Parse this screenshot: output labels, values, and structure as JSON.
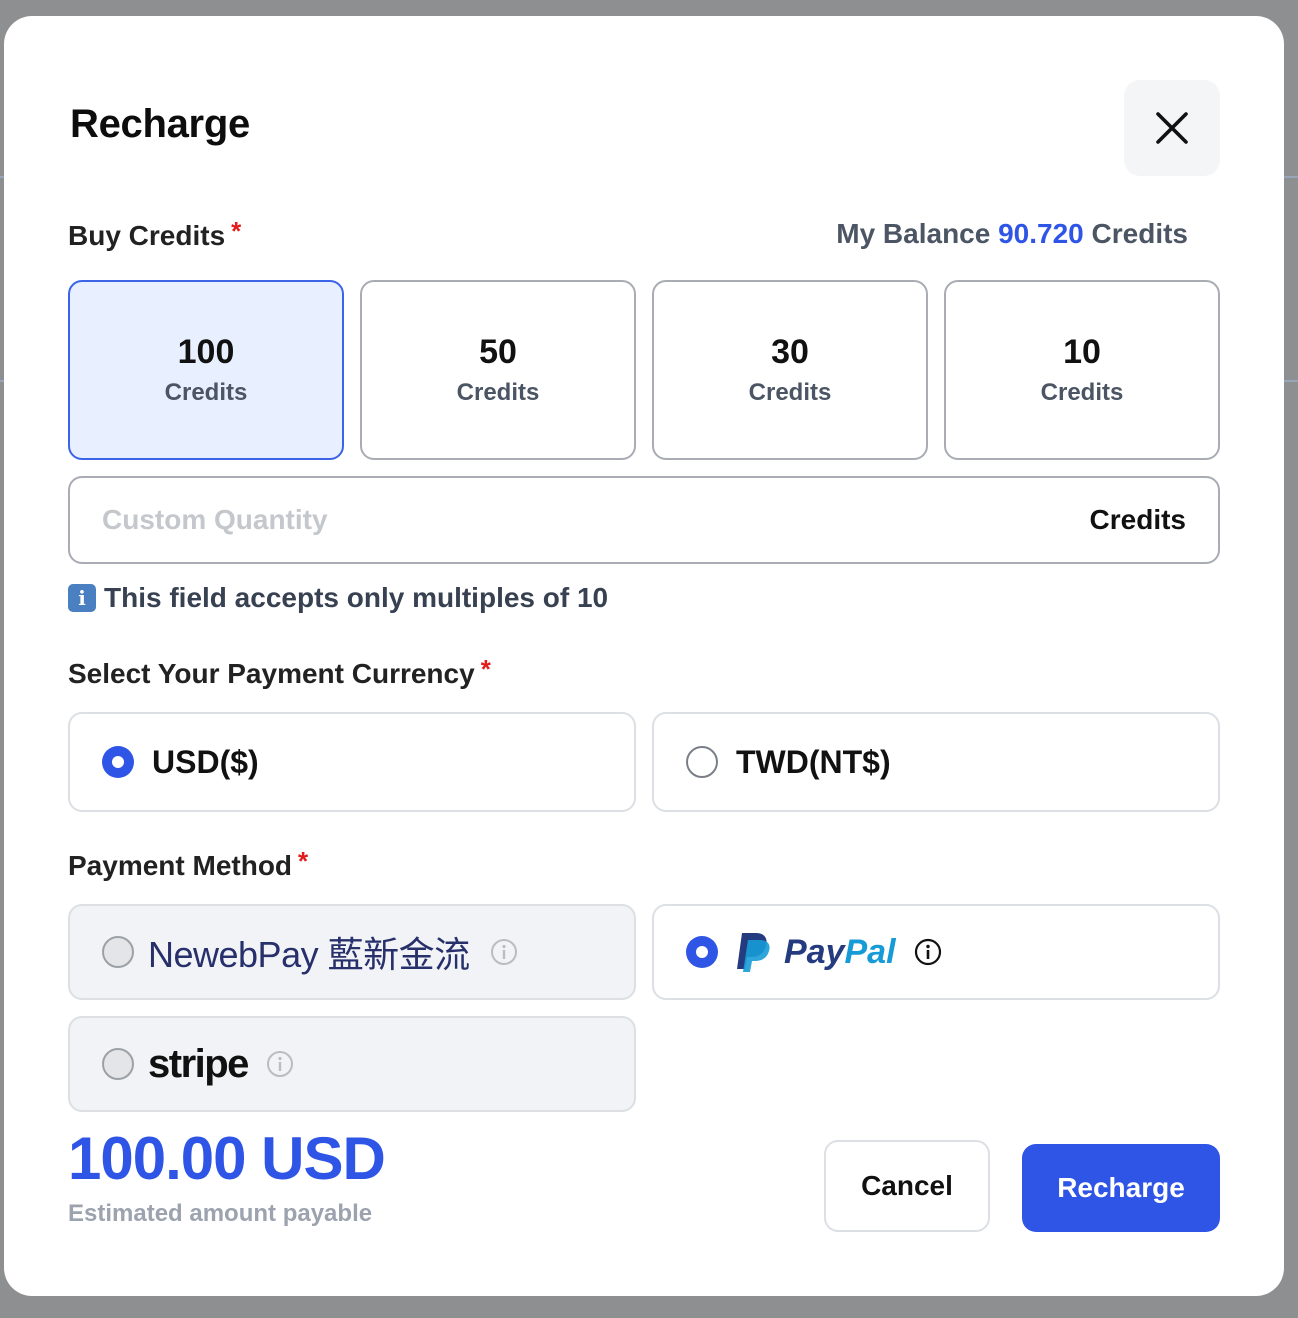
{
  "modal": {
    "title": "Recharge"
  },
  "buy_credits": {
    "label": "Buy Credits",
    "required_mark": "*",
    "balance_prefix": "My Balance",
    "balance_value": "90.720",
    "balance_suffix": "Credits",
    "options": [
      {
        "amount": "100",
        "unit": "Credits",
        "selected": true
      },
      {
        "amount": "50",
        "unit": "Credits",
        "selected": false
      },
      {
        "amount": "30",
        "unit": "Credits",
        "selected": false
      },
      {
        "amount": "10",
        "unit": "Credits",
        "selected": false
      }
    ],
    "custom_placeholder": "Custom Quantity",
    "custom_value": "",
    "custom_suffix": "Credits",
    "hint_icon": "i",
    "hint": "This field accepts only multiples of 10"
  },
  "currency": {
    "label": "Select Your Payment Currency",
    "required_mark": "*",
    "options": [
      {
        "label": "USD($)",
        "selected": true
      },
      {
        "label": "TWD(NT$)",
        "selected": false
      }
    ]
  },
  "payment_method": {
    "label": "Payment Method",
    "required_mark": "*",
    "options": [
      {
        "name": "NewebPay 藍新金流",
        "icon": "newebpay-logo",
        "selected": false,
        "disabled": true
      },
      {
        "name": "PayPal",
        "icon": "paypal-logo",
        "selected": true,
        "disabled": false
      },
      {
        "name": "stripe",
        "icon": "stripe-logo",
        "selected": false,
        "disabled": true
      }
    ]
  },
  "summary": {
    "amount": "100.00 USD",
    "amount_label": "Estimated amount payable"
  },
  "actions": {
    "cancel": "Cancel",
    "confirm": "Recharge"
  },
  "colors": {
    "accent": "#2f55e6",
    "selected_bg": "#e8efff",
    "required": "#e21b1b",
    "paypal_dark": "#253b80",
    "paypal_light": "#179bd7"
  }
}
